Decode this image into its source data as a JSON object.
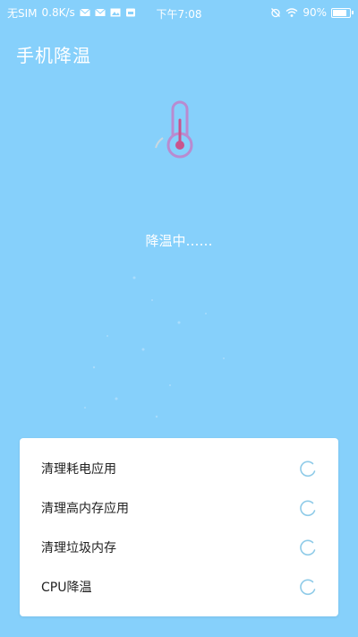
{
  "status_bar": {
    "carrier": "无SIM",
    "speed": "0.8K/s",
    "time": "下午7:08",
    "battery": "90%",
    "battery_level": 0.9
  },
  "header": {
    "title": "手机降温"
  },
  "main": {
    "status": "降温中……"
  },
  "tasks": [
    {
      "label": "清理耗电应用"
    },
    {
      "label": "清理高内存应用"
    },
    {
      "label": "清理垃圾内存"
    },
    {
      "label": "CPU降温"
    }
  ],
  "colors": {
    "background": "#86d0fb",
    "thermometer": "#b98bd0",
    "spinner": "#8fcbe8"
  },
  "icons": [
    "mail-icon",
    "mail-icon",
    "photo-icon",
    "sd-card-icon",
    "alarm-off-icon",
    "wifi-icon",
    "battery-icon",
    "thermometer-icon",
    "spinner-icon"
  ]
}
